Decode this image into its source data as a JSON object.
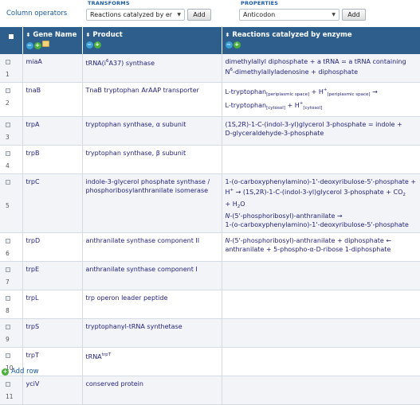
{
  "operators": {
    "column_operators_label": "Column operators",
    "transforms_label": "TRANSFORMS",
    "transforms_value": "Reactions catalyzed by er",
    "properties_label": "PROPERTIES",
    "properties_value": "Anticodon",
    "add_label": "Add"
  },
  "table": {
    "headers": {
      "gene": "Gene Name",
      "product": "Product",
      "reactions": "Reactions catalyzed by enzyme"
    },
    "rows": [
      {
        "num": "1",
        "gene": "miaA",
        "product_pre": "tRNA(i",
        "product_sup": "6",
        "product_post": "A37) synthase",
        "r1": "dimethylallyl diphosphate + a tRNA  =  a tRNA containing",
        "r2_pre": "N",
        "r2_sup": "6",
        "r2_post": "-dimethylallyladenosine + diphosphate"
      },
      {
        "num": "2",
        "gene": "tnaB",
        "product": "TnaB tryptophan ArAAP transporter",
        "r_a": "L-tryptophan",
        "r_a_sub": "[periplasmic space]",
        "r_b": " + H",
        "r_b_sup": "+",
        "r_b_sub": "[periplasmic space]",
        "r_arrow": "  →",
        "r_c": "L-tryptophan",
        "r_c_sub": "[cytosol]",
        "r_d": " + H",
        "r_d_sup": "+",
        "r_d_sub": "[cytosol]"
      },
      {
        "num": "3",
        "gene": "trpA",
        "product": "tryptophan synthase, α subunit",
        "r1": "(1S,2R)-1-C-(indol-3-yl)glycerol 3-phosphate  =  indole +",
        "r2": "D-glyceraldehyde-3-phosphate"
      },
      {
        "num": "4",
        "gene": "trpB",
        "product": "tryptophan synthase, β subunit"
      },
      {
        "num": "5",
        "gene": "trpC",
        "product1": "indole-3-glycerol phosphate synthase /",
        "product2": "phosphoribosylanthranilate isomerase",
        "r1": "1-(o-carboxyphenylamino)-1'-deoxyribulose-5'-phosphate +",
        "r2_pre": "H",
        "r2_sup": "+",
        "r2_post": "  →  (1S,2R)-1-C-(indol-3-yl)glycerol 3-phosphate + CO",
        "r2_sub": "2",
        "r3": "+ H",
        "r3_sub": "2",
        "r3_post": "O",
        "r4_italic": "N",
        "r4": "-(5'-phosphoribosyl)-anthranilate  →",
        "r5": "1-(o-carboxyphenylamino)-1'-deoxyribulose-5'-phosphate"
      },
      {
        "num": "6",
        "gene": "trpD",
        "product": "anthranilate synthase component II",
        "r1_italic": "N",
        "r1": "-(5'-phosphoribosyl)-anthranilate + diphosphate  ←",
        "r2": "anthranilate + 5-phospho-α-D-ribose 1-diphosphate"
      },
      {
        "num": "7",
        "gene": "trpE",
        "product": "anthranilate synthase component I"
      },
      {
        "num": "8",
        "gene": "trpL",
        "product": "trp operon leader peptide"
      },
      {
        "num": "9",
        "gene": "trpS",
        "product": "tryptophanyl-tRNA synthetase"
      },
      {
        "num": "10",
        "gene": "trpT",
        "product_pre": "tRNA",
        "product_sup": "trpT"
      },
      {
        "num": "11",
        "gene": "yciV",
        "product": "conserved protein"
      }
    ]
  },
  "add_row_label": "Add row",
  "colors": {
    "header_bg": "#2e5f8c",
    "link_text": "#23237a",
    "label_blue": "#1a5aa0"
  }
}
